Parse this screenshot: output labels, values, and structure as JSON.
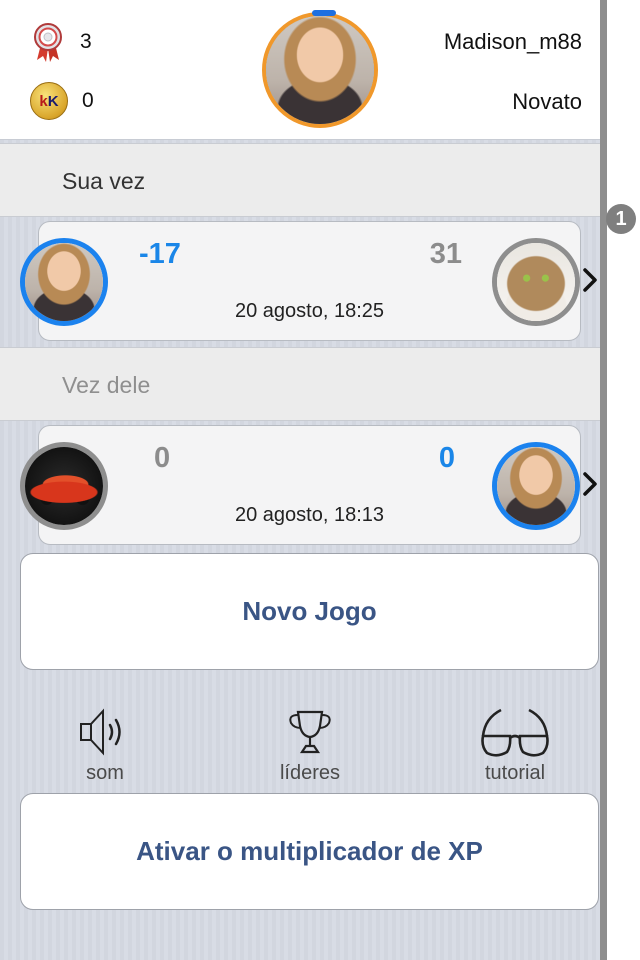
{
  "header": {
    "medals": "3",
    "coins": "0",
    "username": "Madison_m88",
    "rank": "Novato"
  },
  "notification_badge": "1",
  "sections": {
    "your_turn": "Sua vez",
    "their_turn": "Vez dele"
  },
  "games": [
    {
      "left_score": "-17",
      "right_score": "31",
      "date": "20 agosto, 18:25"
    },
    {
      "left_score": "0",
      "right_score": "0",
      "date": "20 agosto, 18:13"
    }
  ],
  "buttons": {
    "new_game": "Novo Jogo",
    "xp_multiplier": "Ativar o multiplicador de XP"
  },
  "toolbar": {
    "sound": "som",
    "leaders": "líderes",
    "tutorial": "tutorial"
  },
  "icons": {
    "medal": "medal-icon",
    "coin": "coin-icon",
    "sound": "speaker-icon",
    "leaders": "trophy-icon",
    "tutorial": "glasses-icon",
    "chevron": "chevron-right-icon"
  },
  "colors": {
    "accent_blue": "#1a86e8",
    "button_text": "#3a5585",
    "ring_orange": "#f0982b",
    "ring_gray": "#8e8e8e"
  }
}
